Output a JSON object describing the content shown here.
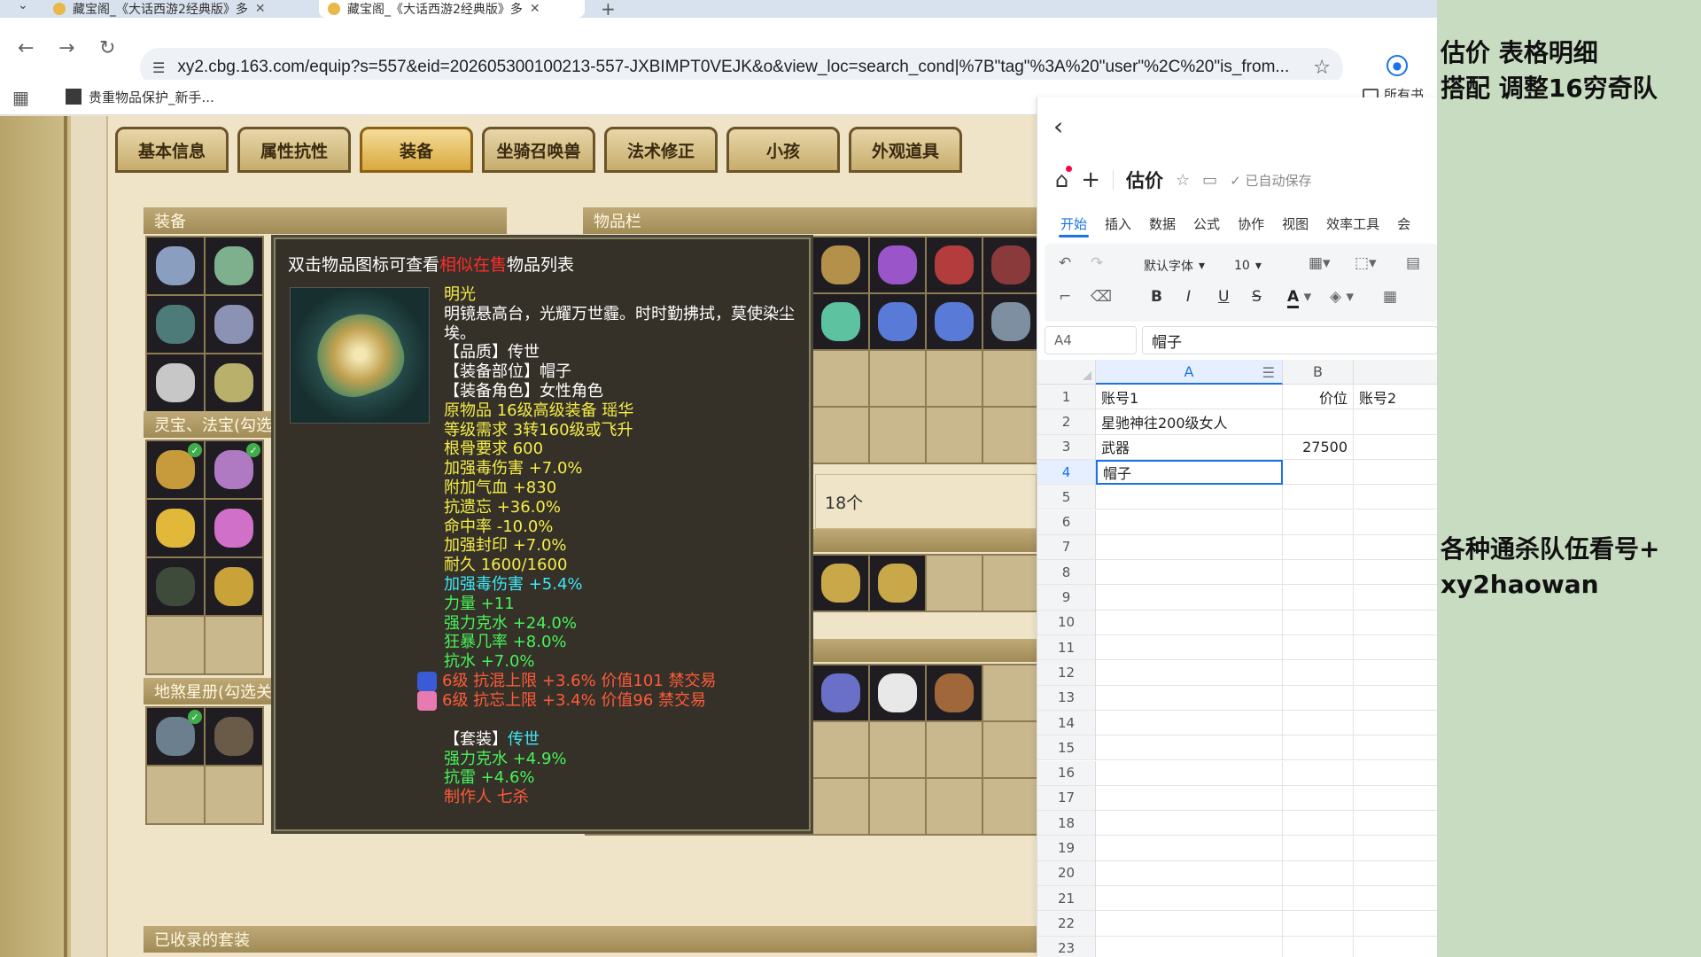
{
  "browser": {
    "tabs": [
      {
        "title": "藏宝阁_《大话西游2经典版》多"
      },
      {
        "title": "藏宝阁_《大话西游2经典版》多"
      }
    ],
    "url": "xy2.cbg.163.com/equip?s=557&eid=202605300100213-557-JXBIMPT0VEJK&o&view_loc=search_cond|%7B\"tag\"%3A%20\"user\"%2C%20\"is_from...",
    "bookmark_1": "贵重物品保护_新手...",
    "bookmark_right": "所有书"
  },
  "game": {
    "tabs": [
      "基本信息",
      "属性抗性",
      "装备",
      "坐骑召唤兽",
      "法术修正",
      "小孩",
      "外观道具"
    ],
    "active_tab": 2,
    "panels": {
      "equipment": "装备",
      "items": "物品栏",
      "lingbao": "灵宝、法宝(勾选",
      "disha": "地煞星册(勾选关",
      "suits": "已收录的套装"
    },
    "item_count": "18个"
  },
  "tooltip": {
    "head_pre": "双击物品图标可查看",
    "head_red": "相似在售",
    "head_post": "物品列表",
    "name": "明光",
    "desc": "明镜悬高台，光耀万世霾。时时勤拂拭，莫使染尘埃。",
    "lines": [
      {
        "text": "【品质】传世",
        "color": "white"
      },
      {
        "text": "【装备部位】帽子",
        "color": "white"
      },
      {
        "text": "【装备角色】女性角色",
        "color": "white"
      },
      {
        "text": "原物品 16级高级装备 瑶华",
        "color": "yellow"
      },
      {
        "text": "等级需求 3转160级或飞升",
        "color": "yellow"
      },
      {
        "text": "根骨要求 600",
        "color": "yellow"
      },
      {
        "text": "加强毒伤害 +7.0%",
        "color": "yellow"
      },
      {
        "text": "附加气血 +830",
        "color": "yellow"
      },
      {
        "text": "抗遗忘 +36.0%",
        "color": "yellow"
      },
      {
        "text": "命中率 -10.0%",
        "color": "yellow"
      },
      {
        "text": "加强封印 +7.0%",
        "color": "yellow"
      },
      {
        "text": "耐久 1600/1600",
        "color": "yellow"
      },
      {
        "text": "加强毒伤害 +5.4%",
        "color": "cyan"
      },
      {
        "text": "力量 +11",
        "color": "green"
      },
      {
        "text": "强力克水 +24.0%",
        "color": "green"
      },
      {
        "text": "狂暴几率 +8.0%",
        "color": "green"
      },
      {
        "text": "抗水 +7.0%",
        "color": "green"
      }
    ],
    "gems": [
      {
        "text": "6级 抗混上限 +3.6% 价值101 禁交易",
        "icon_color": "#3b5bd6"
      },
      {
        "text": "6级 抗忘上限 +3.4% 价值96 禁交易",
        "icon_color": "#e87ab2"
      }
    ],
    "suit_label": "【套装】",
    "suit_name": "传世",
    "suit_lines": [
      "强力克水 +4.9%",
      "抗雷 +4.6%"
    ],
    "maker": "制作人 七杀"
  },
  "sheet": {
    "title": "估价",
    "autosave": "已自动保存",
    "menu": [
      "开始",
      "插入",
      "数据",
      "公式",
      "协作",
      "视图",
      "效率工具",
      "会"
    ],
    "font_name": "默认字体",
    "font_size": "10",
    "cell_ref": "A4",
    "cell_value": "帽子",
    "columns": [
      "A",
      "B"
    ],
    "rows": [
      {
        "n": "1",
        "a": "账号1",
        "b": "价位",
        "c": "账号2"
      },
      {
        "n": "2",
        "a": "星驰神往200级女人",
        "b": "",
        "c": ""
      },
      {
        "n": "3",
        "a": "武器",
        "b": "27500",
        "c": ""
      },
      {
        "n": "4",
        "a": "帽子",
        "b": "",
        "c": ""
      },
      {
        "n": "5",
        "a": "",
        "b": "",
        "c": ""
      },
      {
        "n": "6",
        "a": "",
        "b": "",
        "c": ""
      },
      {
        "n": "7",
        "a": "",
        "b": "",
        "c": ""
      },
      {
        "n": "8",
        "a": "",
        "b": "",
        "c": ""
      },
      {
        "n": "9",
        "a": "",
        "b": "",
        "c": ""
      },
      {
        "n": "10",
        "a": "",
        "b": "",
        "c": ""
      },
      {
        "n": "11",
        "a": "",
        "b": "",
        "c": ""
      },
      {
        "n": "12",
        "a": "",
        "b": "",
        "c": ""
      },
      {
        "n": "13",
        "a": "",
        "b": "",
        "c": ""
      },
      {
        "n": "14",
        "a": "",
        "b": "",
        "c": ""
      },
      {
        "n": "15",
        "a": "",
        "b": "",
        "c": ""
      },
      {
        "n": "16",
        "a": "",
        "b": "",
        "c": ""
      },
      {
        "n": "17",
        "a": "",
        "b": "",
        "c": ""
      },
      {
        "n": "18",
        "a": "",
        "b": "",
        "c": ""
      },
      {
        "n": "19",
        "a": "",
        "b": "",
        "c": ""
      },
      {
        "n": "20",
        "a": "",
        "b": "",
        "c": ""
      },
      {
        "n": "21",
        "a": "",
        "b": "",
        "c": ""
      },
      {
        "n": "22",
        "a": "",
        "b": "",
        "c": ""
      },
      {
        "n": "23",
        "a": "",
        "b": "",
        "c": ""
      }
    ]
  },
  "overlay": {
    "line1": "估价  表格明细",
    "line2": "搭配 调整16穷奇队",
    "line3": "各种通杀队伍看号+",
    "line4": "xy2haowan"
  }
}
